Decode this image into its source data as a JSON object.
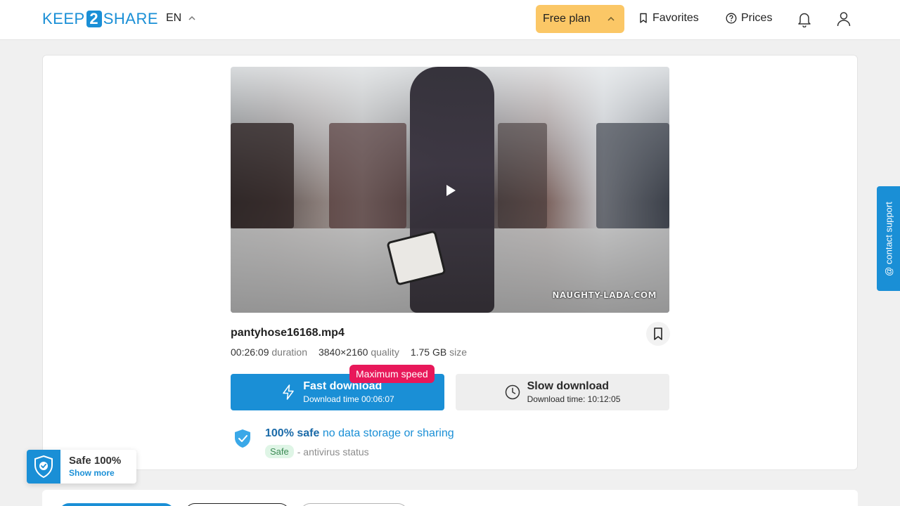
{
  "header": {
    "logo_left": "KEEP",
    "logo_num": "2",
    "logo_right": "SHARE",
    "language": "EN",
    "plan_label": "Free plan",
    "favorites_label": "Favorites",
    "prices_label": "Prices"
  },
  "video": {
    "watermark": "NAUGHTY-LADA.COM"
  },
  "file": {
    "name": "pantyhose16168.mp4",
    "duration_value": "00:26:09",
    "duration_label": "duration",
    "quality_value": "3840×2160",
    "quality_label": "quality",
    "size_value": "1.75 GB",
    "size_label": "size"
  },
  "download": {
    "fast_title": "Fast download",
    "fast_sub": "Download time 00:06:07",
    "badge": "Maximum speed",
    "slow_title": "Slow download",
    "slow_sub": "Download time: 10:12:05"
  },
  "safety": {
    "title_strong": "100% safe",
    "title_light": "no data storage or sharing",
    "pill": "Safe",
    "status_text": "- antivirus status"
  },
  "support": {
    "label": "@ contact support"
  },
  "safe_widget": {
    "title": "Safe 100%",
    "link": "Show more"
  },
  "colors": {
    "accent": "#1a8fd6",
    "plan": "#fbc766",
    "badge": "#e8185a"
  }
}
